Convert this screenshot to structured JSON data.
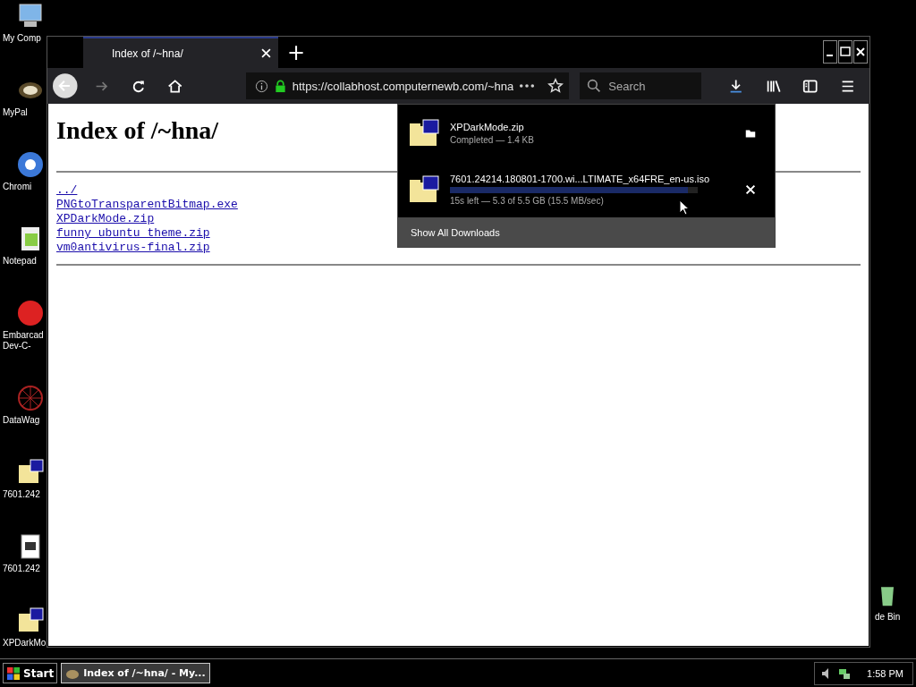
{
  "desktop_icons": [
    {
      "kind": "computer",
      "label": "My Comp"
    },
    {
      "kind": "app",
      "label": "MyPal"
    },
    {
      "kind": "chromium",
      "label": "Chromi"
    },
    {
      "kind": "notepad",
      "label": "Notepad"
    },
    {
      "kind": "devcpp",
      "label": "Embarcad Dev-C-"
    },
    {
      "kind": "datawagon",
      "label": "DataWag"
    },
    {
      "kind": "iso",
      "label": "7601.242"
    },
    {
      "kind": "sevenzip",
      "label": "7601.242"
    },
    {
      "kind": "zip",
      "label": "XPDarkMo"
    }
  ],
  "recycle_bin": {
    "label": "de Bin"
  },
  "browser": {
    "tabs": [
      {
        "title": "Index of /~hna/",
        "selected": true
      }
    ],
    "new_tab": "+",
    "address": "https://collabhost.computernewb.com/~hna",
    "search": {
      "placeholder": "Search"
    },
    "page": {
      "heading": "Index of /~hna/",
      "links": [
        "../",
        "PNGtoTransparentBitmap.exe",
        "XPDarkMode.zip",
        "funny ubuntu theme.zip",
        "vm0antivirus-final.zip"
      ]
    },
    "downloads": {
      "items": [
        {
          "kind": "completed",
          "name": "XPDarkMode.zip",
          "status": "Completed — 1.4 KB"
        },
        {
          "kind": "in_progress",
          "name": "7601.24214.180801-1700.wi...LTIMATE_x64FRE_en-us.iso",
          "level": 0.96,
          "status": "15s left — 5.3 of 5.5 GB (15.5 MB/sec)"
        }
      ],
      "footer": "Show All Downloads"
    }
  },
  "taskbar": {
    "start": "Start",
    "tasks": [
      {
        "label": "Index of /~hna/ - My...",
        "selected": true
      }
    ],
    "clock": "1:58 PM"
  }
}
